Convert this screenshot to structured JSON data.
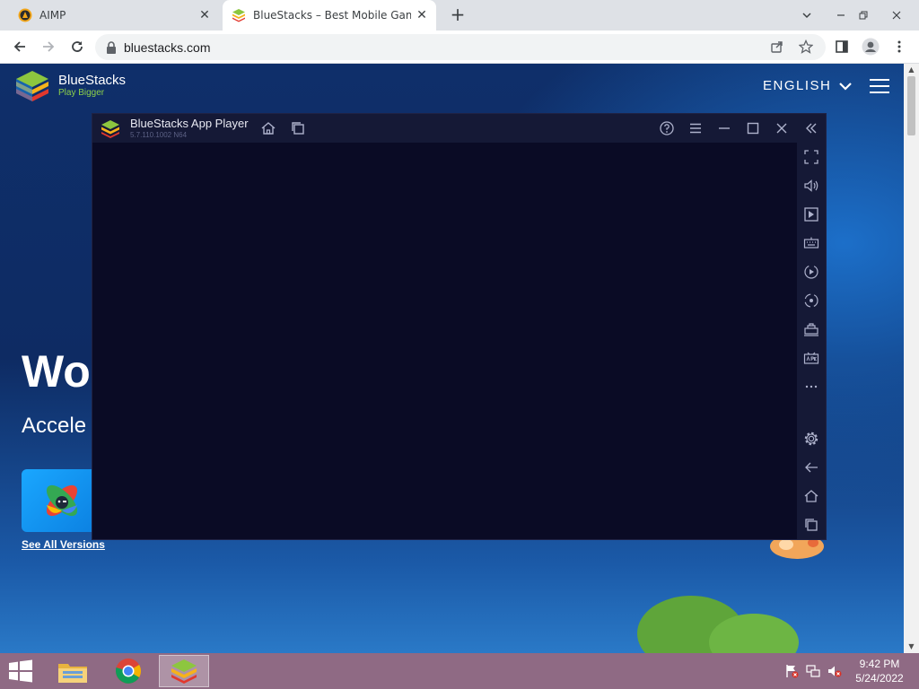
{
  "browser": {
    "tabs": [
      {
        "title": "AIMP",
        "active": false
      },
      {
        "title": "BlueStacks – Best Mobile Gaming Platform",
        "active": true
      }
    ],
    "new_tab_symbol": "+",
    "close_symbol": "✕",
    "url": "bluestacks.com"
  },
  "website": {
    "brand_name": "BlueStacks",
    "tagline": "Play Bigger",
    "language": "ENGLISH",
    "hero_title": "Wo",
    "hero_subtitle": "Accele",
    "see_all_versions": "See All Versions"
  },
  "app_player": {
    "title": "BlueStacks App Player",
    "version": "5.7.110.1002  N64",
    "sidebar_tools": [
      "fullscreen-icon",
      "volume-icon",
      "screenshot-icon",
      "keyboard-icon",
      "macro-record-icon",
      "rotate-icon",
      "multi-instance-icon",
      "apk-install-icon",
      "more-icon",
      "settings-icon",
      "back-icon",
      "home-icon",
      "recent-apps-icon"
    ]
  },
  "taskbar": {
    "time": "9:42 PM",
    "date": "5/24/2022"
  },
  "colors": {
    "page_bg": "#0f2f6a",
    "player_bg": "#0d0f2b",
    "player_chrome": "#151936",
    "taskbar": "#8f6a84",
    "tagline_green": "#8dd04a"
  }
}
